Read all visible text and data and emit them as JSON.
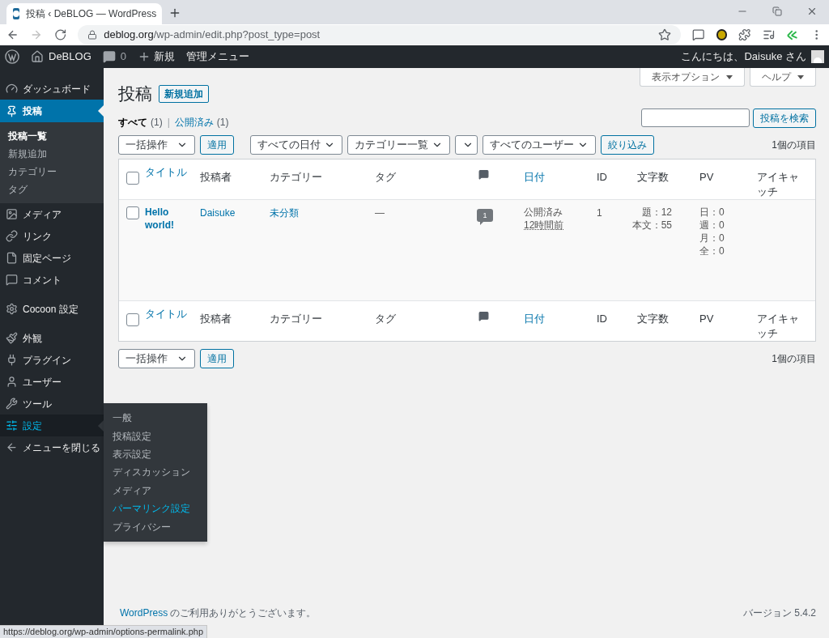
{
  "browser": {
    "tab_title": "投稿 ‹ DeBLOG — WordPress",
    "url_host": "deblog.org",
    "url_path": "/wp-admin/edit.php?post_type=post"
  },
  "admin_bar": {
    "site": "DeBLOG",
    "comments": "0",
    "new": "新規",
    "admin_menu": "管理メニュー",
    "greeting": "こんにちは、Daisuke さん"
  },
  "sidebar": {
    "groups": [
      [
        {
          "label": "ダッシュボード",
          "selected": false,
          "highlighted": false
        },
        {
          "label": "投稿",
          "selected": true,
          "highlighted": false,
          "children": [
            {
              "label": "投稿一覧",
              "selected": true
            },
            {
              "label": "新規追加",
              "selected": false
            },
            {
              "label": "カテゴリー",
              "selected": false
            },
            {
              "label": "タグ",
              "selected": false
            }
          ]
        },
        {
          "label": "メディア",
          "selected": false,
          "highlighted": false
        },
        {
          "label": "リンク",
          "selected": false,
          "highlighted": false
        },
        {
          "label": "固定ページ",
          "selected": false,
          "highlighted": false
        },
        {
          "label": "コメント",
          "selected": false,
          "highlighted": false
        }
      ],
      [
        {
          "label": "Cocoon 設定",
          "selected": false,
          "highlighted": false
        }
      ],
      [
        {
          "label": "外観",
          "selected": false,
          "highlighted": false
        },
        {
          "label": "プラグイン",
          "selected": false,
          "highlighted": false
        },
        {
          "label": "ユーザー",
          "selected": false,
          "highlighted": false
        },
        {
          "label": "ツール",
          "selected": false,
          "highlighted": false
        },
        {
          "label": "設定",
          "selected": false,
          "highlighted": true,
          "flyout": [
            {
              "label": "一般",
              "highlighted": false
            },
            {
              "label": "投稿設定",
              "highlighted": false
            },
            {
              "label": "表示設定",
              "highlighted": false
            },
            {
              "label": "ディスカッション",
              "highlighted": false
            },
            {
              "label": "メディア",
              "highlighted": false
            },
            {
              "label": "パーマリンク設定",
              "highlighted": true
            },
            {
              "label": "プライバシー",
              "highlighted": false
            }
          ]
        },
        {
          "label": "メニューを閉じる",
          "selected": false,
          "highlighted": false
        }
      ]
    ]
  },
  "screen_tabs": [
    "表示オプション",
    "ヘルプ"
  ],
  "page": {
    "title": "投稿",
    "add_new": "新規追加",
    "view_separator": "|",
    "views": [
      {
        "label": "すべて",
        "count": "(1)",
        "selected": true
      },
      {
        "label": "公開済み",
        "count": "(1)",
        "selected": false
      }
    ],
    "search_button": "投稿を検索",
    "top_actions": {
      "bulk": "一括操作",
      "apply": "適用",
      "filters": [
        {
          "kind": "select",
          "value": "すべての日付"
        },
        {
          "kind": "select",
          "value": "カテゴリー一覧"
        },
        {
          "kind": "blank"
        },
        {
          "kind": "select",
          "value": "すべてのユーザー"
        }
      ],
      "filter_button": "絞り込み",
      "count": "1個の項目"
    },
    "table": {
      "header_columns": [
        {
          "kind": "checkbox",
          "checked": false
        },
        {
          "kind": "text",
          "label": "タイトル",
          "sortable": true
        },
        {
          "kind": "text",
          "label": "投稿者",
          "sortable": false
        },
        {
          "kind": "text",
          "label": "カテゴリー",
          "sortable": false
        },
        {
          "kind": "text",
          "label": "タグ",
          "sortable": false
        },
        {
          "kind": "comment_icon"
        },
        {
          "kind": "text",
          "label": "日付",
          "sortable": true
        },
        {
          "kind": "text",
          "label": "ID",
          "sortable": false
        },
        {
          "kind": "text",
          "label": "文字数",
          "sortable": false
        },
        {
          "kind": "text",
          "label": "PV",
          "sortable": false
        },
        {
          "kind": "text",
          "label": "アイキャッチ",
          "sortable": false
        }
      ],
      "rows": [
        {
          "checked": false,
          "title": "Hello world!",
          "author": "Daisuke",
          "category": "未分類",
          "tags": "—",
          "comments": "1",
          "status": "公開済み",
          "date": "12時間前",
          "id": "1",
          "char_counts": [
            "題：12",
            "本文：55"
          ],
          "pv": [
            "日：0",
            "週：0",
            "月：0",
            "全：0"
          ]
        }
      ],
      "footer_columns": [
        {
          "kind": "checkbox",
          "checked": false
        },
        {
          "kind": "text",
          "label": "タイトル",
          "sortable": true
        },
        {
          "kind": "text",
          "label": "投稿者",
          "sortable": false
        },
        {
          "kind": "text",
          "label": "カテゴリー",
          "sortable": false
        },
        {
          "kind": "text",
          "label": "タグ",
          "sortable": false
        },
        {
          "kind": "comment_icon"
        },
        {
          "kind": "text",
          "label": "日付",
          "sortable": true
        },
        {
          "kind": "text",
          "label": "ID",
          "sortable": false
        },
        {
          "kind": "text",
          "label": "文字数",
          "sortable": false
        },
        {
          "kind": "text",
          "label": "PV",
          "sortable": false
        },
        {
          "kind": "text",
          "label": "アイキャッチ",
          "sortable": false
        }
      ]
    },
    "bottom_actions": {
      "bulk": "一括操作",
      "apply": "適用",
      "count": "1個の項目"
    }
  },
  "footer": {
    "thanks_link": "WordPress",
    "thanks": "のご利用ありがとうございます。",
    "version": "バージョン 5.4.2"
  },
  "status_url": "https://deblog.org/wp-admin/options-permalink.php"
}
